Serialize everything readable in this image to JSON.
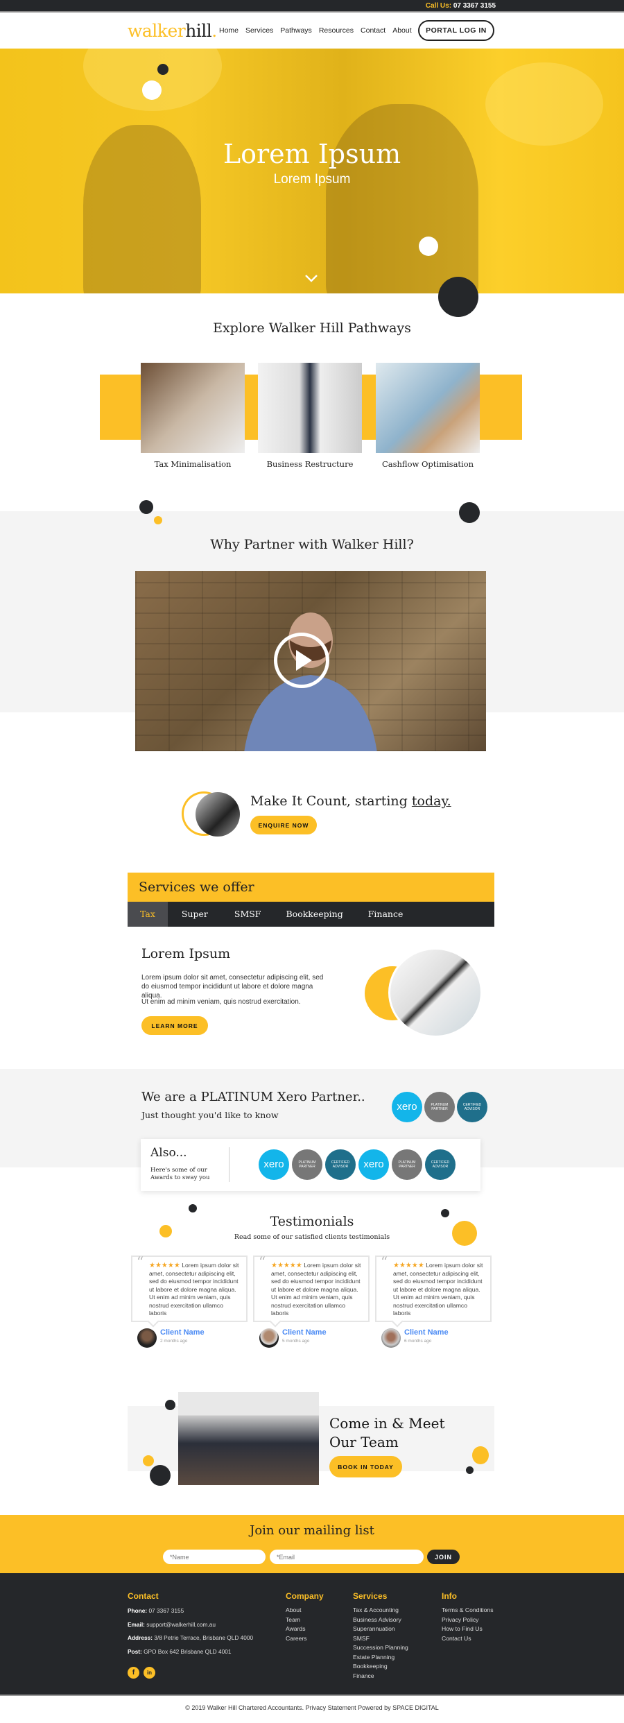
{
  "colors": {
    "accent": "#fcbf26",
    "dark": "#25272a",
    "link": "#4a8af4",
    "xero": "#13b5ea"
  },
  "topbar": {
    "call_label": "Call Us:",
    "phone": "07 3367 3155"
  },
  "header": {
    "logo_part1": "walker",
    "logo_part2": "hill",
    "logo_dot": ".",
    "nav": [
      "Home",
      "Services",
      "Pathways",
      "Resources",
      "Contact",
      "About"
    ],
    "portal_button": "PORTAL LOG IN"
  },
  "hero": {
    "title": "Lorem Ipsum",
    "subtitle": "Lorem Ipsum",
    "scroll_icon": "chevron-down-icon"
  },
  "pathways": {
    "title": "Explore Walker Hill Pathways",
    "items": [
      {
        "label": "Tax Minimalisation"
      },
      {
        "label": "Business Restructure"
      },
      {
        "label": "Cashflow Optimisation"
      }
    ]
  },
  "why": {
    "title": "Why Partner with Walker Hill?",
    "video_icon": "play-icon"
  },
  "cta": {
    "title_start": "Make It Count, starting ",
    "title_emph": "today.",
    "button": "ENQUIRE NOW"
  },
  "services": {
    "title": "Services we offer",
    "tabs": [
      "Tax",
      "Super",
      "SMSF",
      "Bookkeeping",
      "Finance"
    ],
    "active_tab": "Tax",
    "content_title": "Lorem Ipsum",
    "p1": "Lorem ipsum dolor sit amet, consectetur adipiscing elit, sed do eiusmod tempor incididunt ut labore et dolore magna aliqua.",
    "p2": "Ut enim ad minim veniam, quis nostrud exercitation.",
    "button": "LEARN MORE"
  },
  "xero": {
    "title": "We are a PLATINUM Xero Partner..",
    "subtitle": "Just thought you'd like to know",
    "badges": {
      "xero": "xero",
      "platinum": "PLATINUM PARTNER",
      "certified": "CERTIFIED ADVISOR"
    },
    "also_title": "Also...",
    "also_text": "Here's some of our Awards to sway you"
  },
  "testimonials": {
    "title": "Testimonials",
    "subtitle": "Read some of our satisfied clients testimonials",
    "stars": "★★★★★",
    "items": [
      {
        "text": "Lorem ipsum dolor sit amet, consectetur adipiscing elit, sed do eiusmod tempor incididunt ut labore et dolore magna aliqua. Ut enim ad minim veniam, quis nostrud exercitation ullamco laboris",
        "name": "Client Name",
        "time": "2 months ago",
        "rating": 5
      },
      {
        "text": "Lorem ipsum dolor sit amet, consectetur adipiscing elit, sed do eiusmod tempor incididunt ut labore et dolore magna aliqua. Ut enim ad minim veniam, quis nostrud exercitation ullamco laboris",
        "name": "Client Name",
        "time": "5 months ago",
        "rating": 5
      },
      {
        "text": "Lorem ipsum dolor sit amet, consectetur adipiscing elit, sed do eiusmod tempor incididunt ut labore et dolore magna aliqua. Ut enim ad minim veniam, quis nostrud exercitation ullamco laboris",
        "name": "Client Name",
        "time": "6 months ago",
        "rating": 5
      }
    ]
  },
  "team": {
    "title_line1": "Come in & Meet",
    "title_line2": "Our Team",
    "button": "BOOK IN TODAY"
  },
  "mailing": {
    "title": "Join our mailing list",
    "name_placeholder": "*Name",
    "email_placeholder": "*Email",
    "button": "JOIN"
  },
  "footer": {
    "contact": {
      "heading": "Contact",
      "phone_label": "Phone:",
      "phone": "07 3367 3155",
      "email_label": "Email:",
      "email": "support@walkerhill.com.au",
      "address_label": "Address:",
      "address": "3/8 Petrie Terrace, Brisbane QLD 4000",
      "post_label": "Post:",
      "post": "GPO Box 642 Brisbane QLD 4001",
      "social": [
        "facebook-icon",
        "linkedin-icon"
      ]
    },
    "company": {
      "heading": "Company",
      "links": [
        "About",
        "Team",
        "Awards",
        "Careers"
      ]
    },
    "services": {
      "heading": "Services",
      "links": [
        "Tax & Accounting",
        "Business Advisory",
        "Superannuation",
        "SMSF",
        "Succession Planning",
        "Estate Planning",
        "Bookkeeping",
        "Finance"
      ]
    },
    "info": {
      "heading": "Info",
      "links": [
        "Terms & Conditions",
        "Privacy Policy",
        "How to Find Us",
        "Contact Us"
      ]
    },
    "copyright": "© 2019 Walker Hill Chartered Accountants. Privacy Statement Powered by SPACE DIGITAL"
  }
}
